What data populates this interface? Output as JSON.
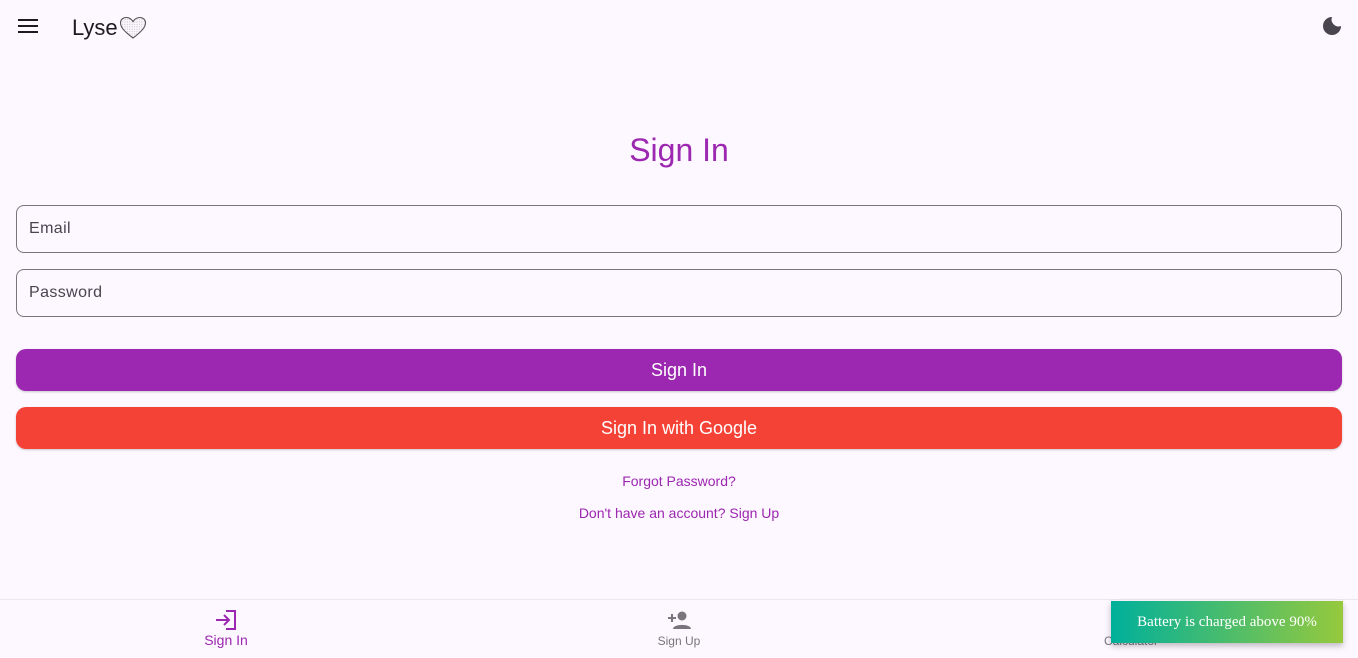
{
  "header": {
    "title": "Lyse",
    "menu_icon": "menu-icon",
    "logo_icon": "heart-icon",
    "theme_icon": "dark-mode-moon-icon"
  },
  "form": {
    "heading": "Sign In",
    "email_placeholder": "Email",
    "email_value": "",
    "password_placeholder": "Password",
    "password_value": "",
    "signin_label": "Sign In",
    "google_label": "Sign In with Google",
    "forgot_link": "Forgot Password?",
    "signup_link": "Don't have an account? Sign Up"
  },
  "bottom_nav": {
    "items": [
      {
        "label": "Sign In",
        "icon": "login-icon",
        "active": true
      },
      {
        "label": "Sign Up",
        "icon": "person-add-icon",
        "active": false
      },
      {
        "label": "Calculator",
        "icon": "calculator-icon",
        "active": false
      }
    ]
  },
  "toast": {
    "message": "Battery is charged above 90%"
  },
  "colors": {
    "primary": "#9c27b0",
    "google": "#f44336",
    "background": "#fdf7ff",
    "toast_start": "#00b09b",
    "toast_end": "#96c93d"
  }
}
